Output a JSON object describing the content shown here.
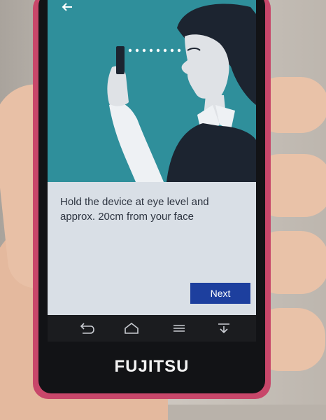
{
  "onboarding": {
    "instruction": "Hold the device at eye level and approx. 20cm from your face",
    "next_label": "Next"
  },
  "device": {
    "brand": "FUJITSU"
  },
  "icons": {
    "top_left": "back-arrow-icon",
    "nav": [
      "back-icon",
      "home-icon",
      "menu-icon",
      "download-icon"
    ]
  },
  "colors": {
    "illustration_bg": "#2f8f9b",
    "panel_bg": "#d9dfe6",
    "button_bg": "#1d3f9e",
    "phone_case": "#c8476a"
  }
}
